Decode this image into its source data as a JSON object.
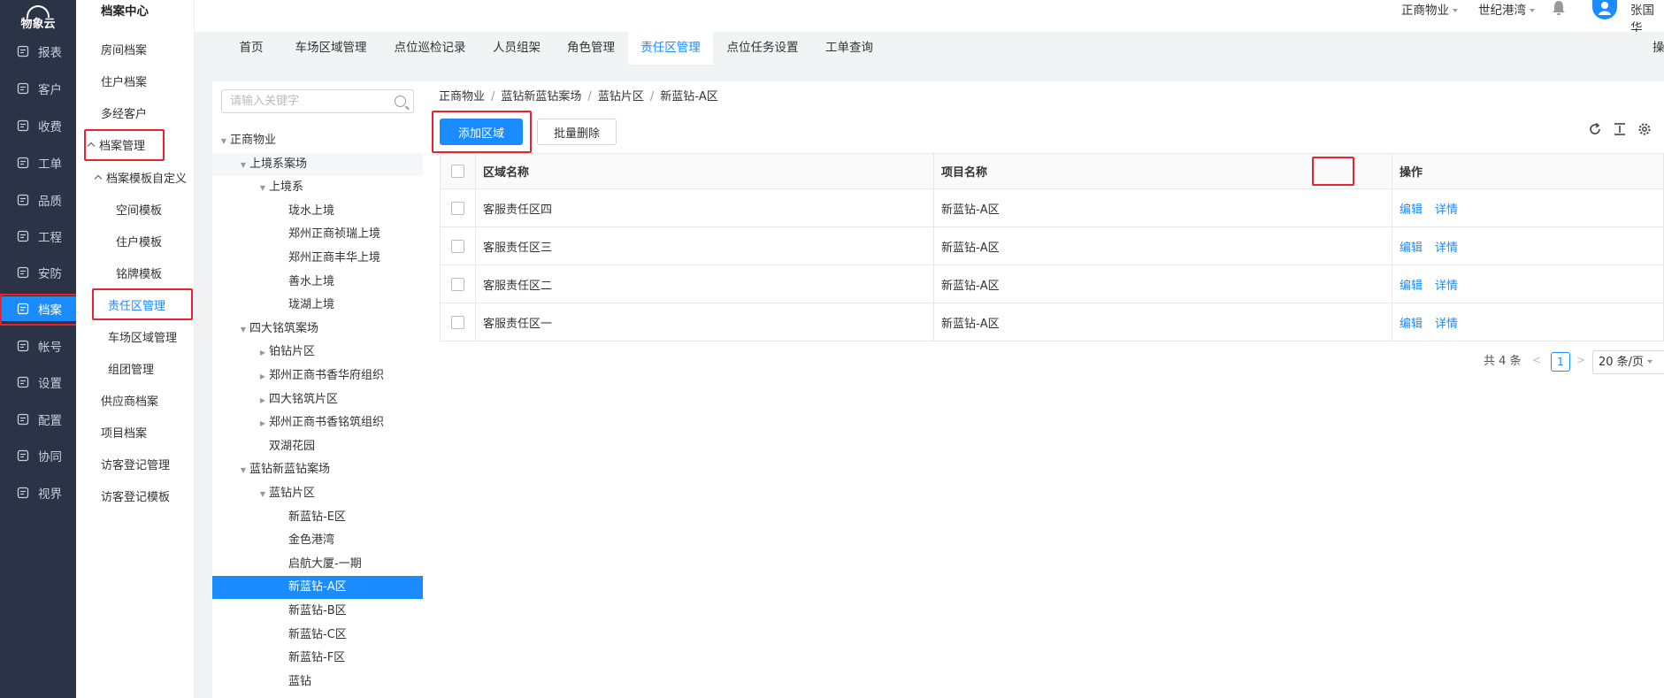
{
  "nav": {
    "logo": "物象云",
    "items": [
      {
        "label": "报表",
        "icon": "report-icon"
      },
      {
        "label": "客户",
        "icon": "user-icon"
      },
      {
        "label": "收费",
        "icon": "money-icon"
      },
      {
        "label": "工单",
        "icon": "clipboard-icon"
      },
      {
        "label": "品质",
        "icon": "quality-icon"
      },
      {
        "label": "工程",
        "icon": "engineering-icon"
      },
      {
        "label": "安防",
        "icon": "security-icon"
      },
      {
        "label": "档案",
        "icon": "archive-icon"
      },
      {
        "label": "帐号",
        "icon": "account-icon"
      },
      {
        "label": "设置",
        "icon": "gear-icon"
      },
      {
        "label": "配置",
        "icon": "config-icon"
      },
      {
        "label": "协同",
        "icon": "collab-icon"
      },
      {
        "label": "视界",
        "icon": "vision-icon"
      }
    ]
  },
  "sub": {
    "title": "档案中心",
    "items": [
      "房间档案",
      "住户档案",
      "多经客户",
      "档案管理",
      "档案模板自定义",
      "空间模板",
      "住户模板",
      "铭牌模板",
      "责任区管理",
      "车场区域管理",
      "组团管理",
      "供应商档案",
      "项目档案",
      "访客登记管理",
      "访客登记模板"
    ]
  },
  "header": {
    "org": "正商物业",
    "project": "世纪港湾",
    "user": "张国华"
  },
  "tabs": [
    "首页",
    "车场区域管理",
    "点位巡检记录",
    "人员组架",
    "角色管理",
    "责任区管理",
    "点位任务设置",
    "工单查询"
  ],
  "tab_more": "操",
  "tree": {
    "search_placeholder": "请输入关键字",
    "nodes": [
      "正商物业",
      "上境系案场",
      "上境系",
      "珑水上境",
      "郑州正商祯瑞上境",
      "郑州正商丰华上境",
      "善水上境",
      "珑湖上境",
      "四大铭筑案场",
      "铂钻片区",
      "郑州正商书香华府组织",
      "四大铭筑片区",
      "郑州正商书香铭筑组织",
      "双湖花园",
      "蓝钻新蓝钻案场",
      "蓝钻片区",
      "新蓝钻-E区",
      "金色港湾",
      "启航大厦-一期",
      "新蓝钻-A区",
      "新蓝钻-B区",
      "新蓝钻-C区",
      "新蓝钻-F区",
      "蓝钻"
    ]
  },
  "breadcrumb": [
    "正商物业",
    "蓝钻新蓝钻案场",
    "蓝钻片区",
    "新蓝钻-A区"
  ],
  "toolbar": {
    "add_label": "添加区域",
    "batch_delete_label": "批量删除"
  },
  "table": {
    "columns": [
      "区域名称",
      "项目名称",
      "操作"
    ],
    "rows": [
      {
        "name": "客服责任区四",
        "project": "新蓝钻-A区"
      },
      {
        "name": "客服责任区三",
        "project": "新蓝钻-A区"
      },
      {
        "name": "客服责任区二",
        "project": "新蓝钻-A区"
      },
      {
        "name": "客服责任区一",
        "project": "新蓝钻-A区"
      }
    ],
    "edit_label": "编辑",
    "detail_label": "详情"
  },
  "pagination": {
    "total": "共 4 条",
    "current": "1",
    "page_size": "20 条/页"
  }
}
